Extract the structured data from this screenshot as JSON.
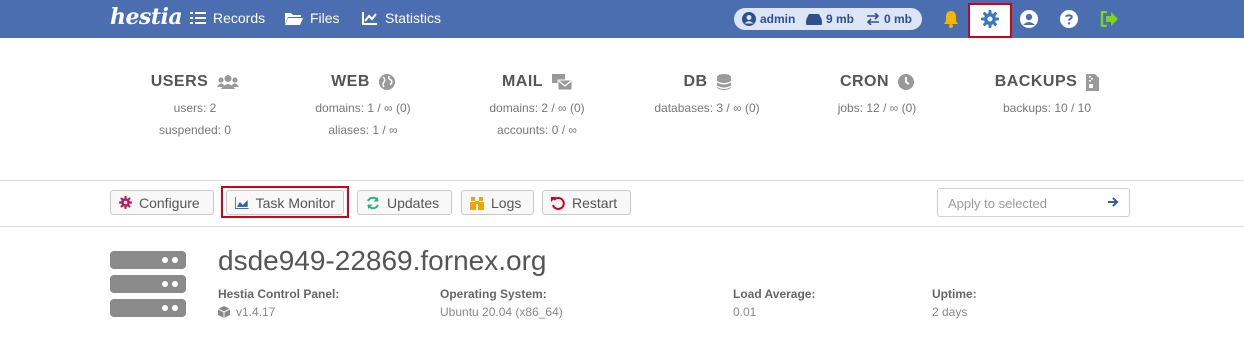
{
  "nav": {
    "logo": "hestia",
    "records": "Records",
    "files": "Files",
    "statistics": "Statistics"
  },
  "user_pill": {
    "username": "admin",
    "disk": "9 mb",
    "bandwidth": "0 mb"
  },
  "icons": {
    "bell": "bell-icon",
    "settings": "gear-icon",
    "account": "user-circle-icon",
    "help": "question-icon",
    "logout": "logout-icon"
  },
  "stats": {
    "users": {
      "title": "USERS",
      "line1": "users: 2",
      "line2": "suspended: 0"
    },
    "web": {
      "title": "WEB",
      "line1": "domains: 1 / ∞ (0)",
      "line2": "aliases: 1 / ∞"
    },
    "mail": {
      "title": "MAIL",
      "line1": "domains: 2 / ∞ (0)",
      "line2": "accounts: 0 / ∞"
    },
    "db": {
      "title": "DB",
      "line1": "databases: 3 / ∞ (0)"
    },
    "cron": {
      "title": "CRON",
      "line1": "jobs: 12 / ∞ (0)"
    },
    "backups": {
      "title": "BACKUPS",
      "line1": "backups: 10 / 10"
    }
  },
  "toolbar": {
    "configure": "Configure",
    "task_monitor": "Task Monitor",
    "updates": "Updates",
    "logs": "Logs",
    "restart": "Restart",
    "apply_placeholder": "Apply to selected"
  },
  "server": {
    "hostname": "dsde949-22869.fornex.org",
    "hcp_label": "Hestia Control Panel:",
    "hcp_value": "v1.4.17",
    "os_label": "Operating System:",
    "os_value": "Ubuntu 20.04 (x86_64)",
    "load_label": "Load Average:",
    "load_value": "0.01",
    "uptime_label": "Uptime:",
    "uptime_value": "2 days"
  },
  "colors": {
    "topbar": "#4a6eb0",
    "highlight": "#d0021b",
    "bell": "#f4b400",
    "settings": "#3a78c2",
    "logout": "#7ed321",
    "updates_icon": "#2ab27b",
    "restart_icon": "#d0021b"
  }
}
